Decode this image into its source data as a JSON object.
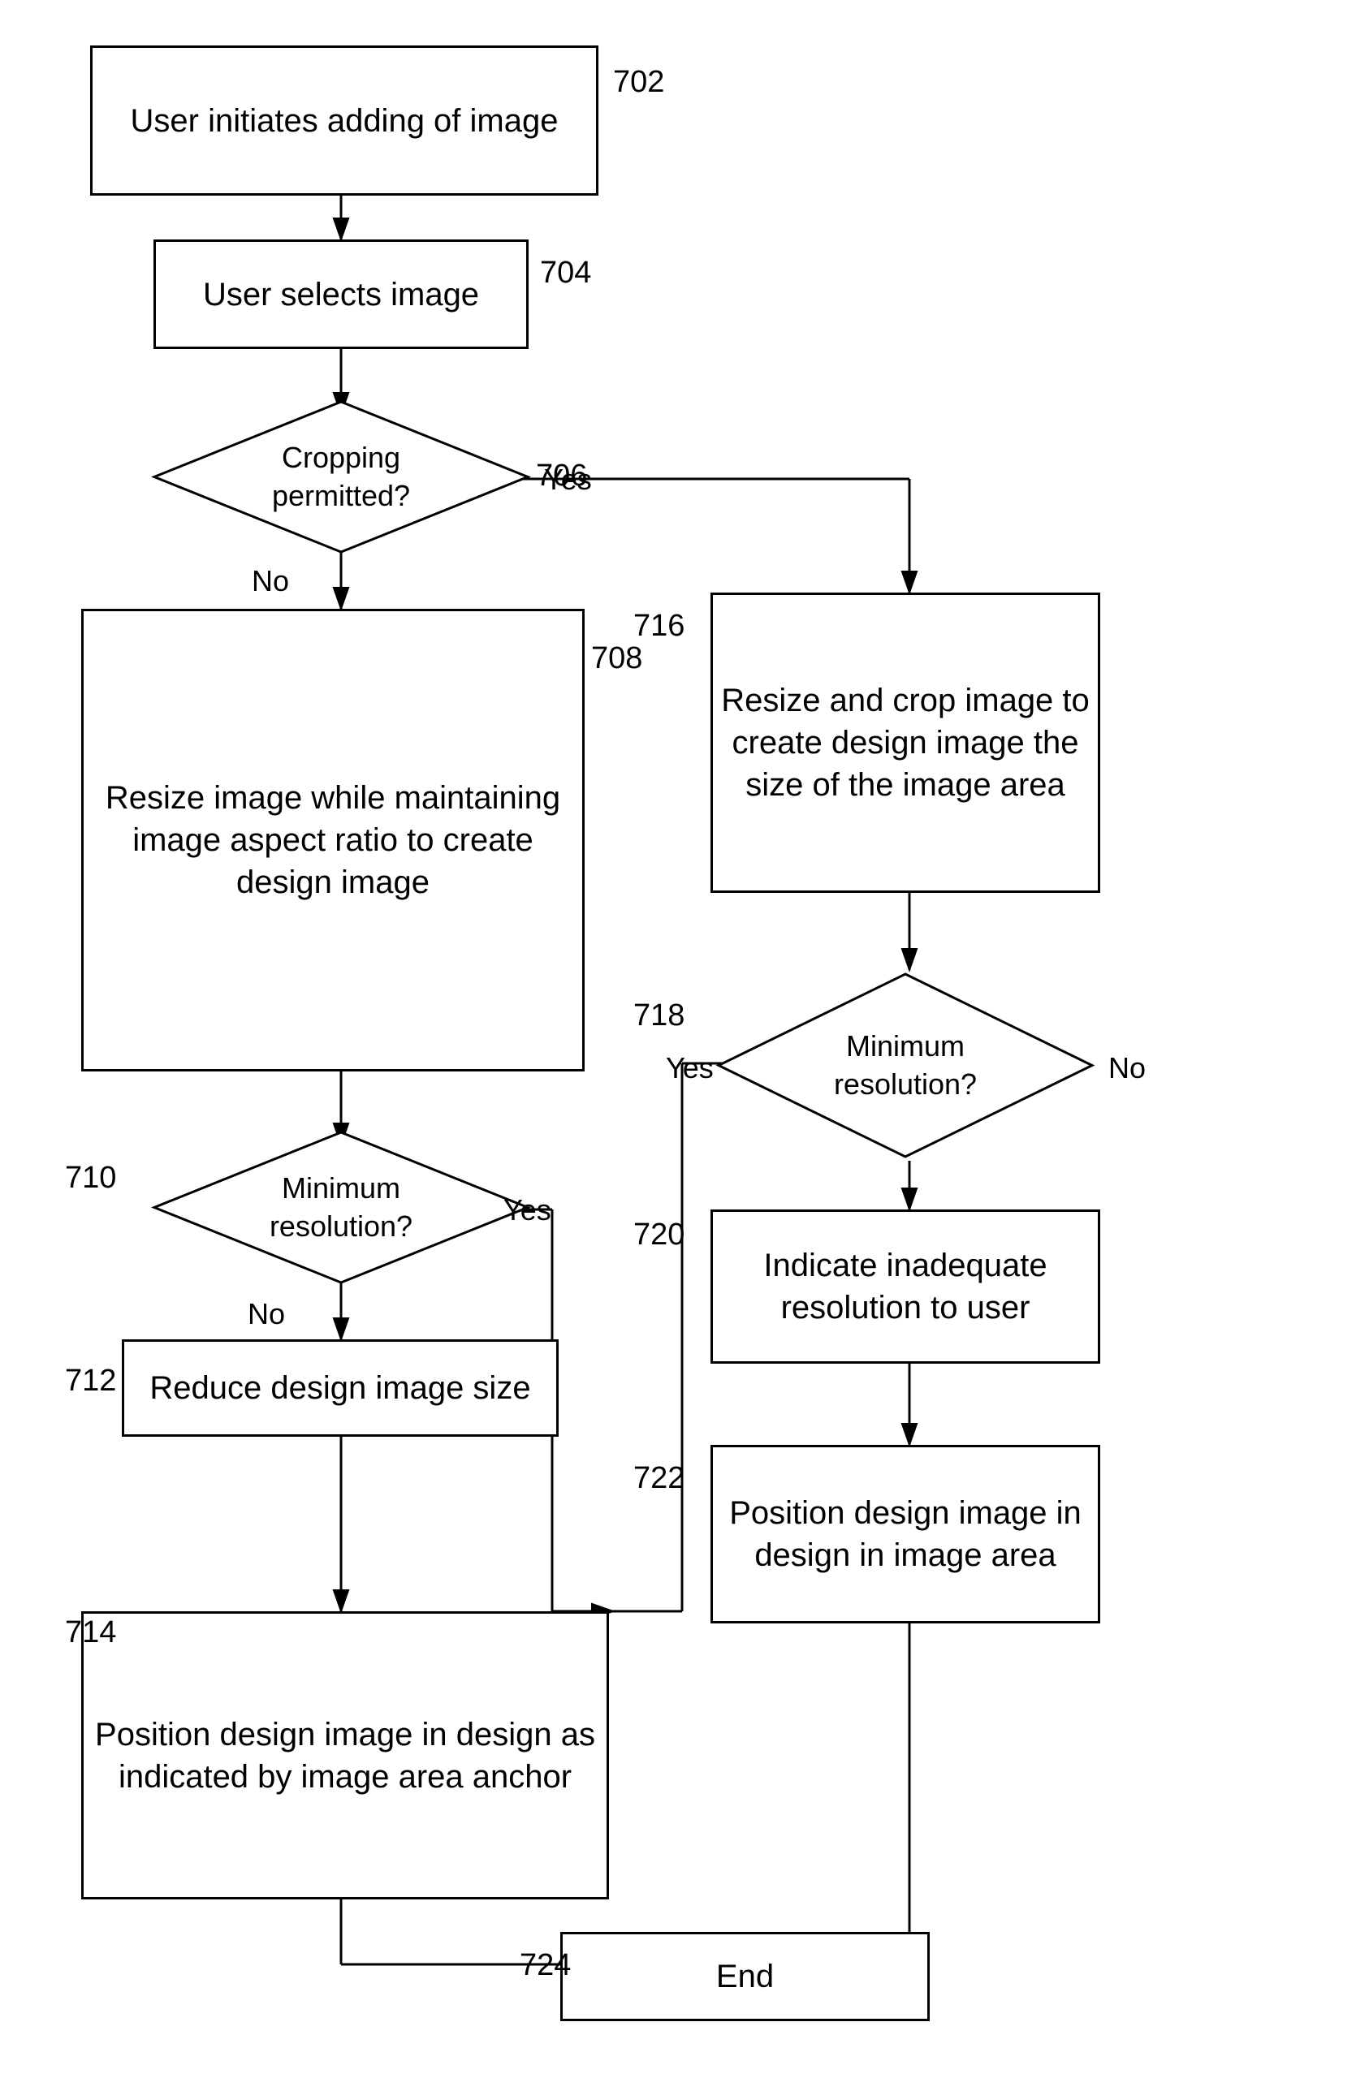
{
  "nodes": {
    "702": {
      "label": "User initiates adding of image",
      "ref": "702"
    },
    "704": {
      "label": "User selects image",
      "ref": "704"
    },
    "706": {
      "label": "Cropping permitted?",
      "ref": "706"
    },
    "708": {
      "label": "Resize image while maintaining image aspect ratio to create design image",
      "ref": "708"
    },
    "710": {
      "label": "Minimum resolution?",
      "ref": "710"
    },
    "712": {
      "label": "Reduce design image size",
      "ref": "712"
    },
    "714": {
      "label": "Position design image in design as indicated by image area anchor",
      "ref": "714"
    },
    "716": {
      "label": "Resize and crop image to create design image the size of the image area",
      "ref": "716"
    },
    "718": {
      "label": "Minimum resolution?",
      "ref": "718"
    },
    "720": {
      "label": "Indicate inadequate resolution to user",
      "ref": "720"
    },
    "722": {
      "label": "Position design image in design in image area",
      "ref": "722"
    },
    "724": {
      "label": "End",
      "ref": "724"
    }
  },
  "arrows": {
    "yes_label": "Yes",
    "no_label": "No"
  }
}
